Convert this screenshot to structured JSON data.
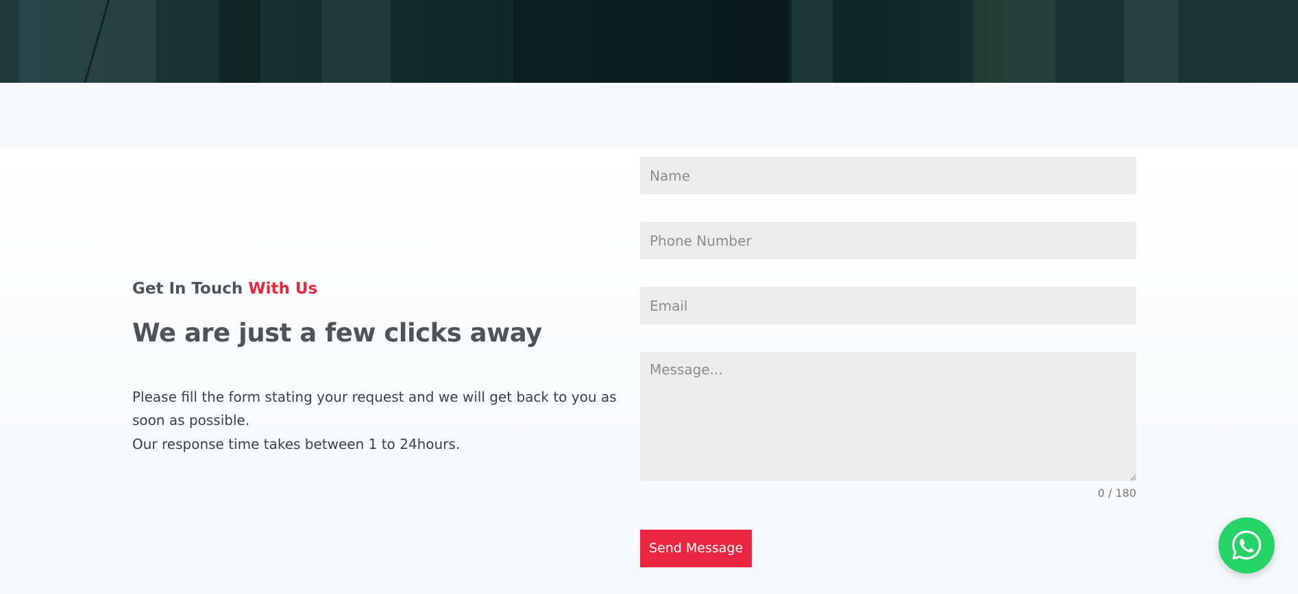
{
  "hero": {
    "image_description": "dark teal-tinted interior photo banner"
  },
  "contact": {
    "eyebrow_prefix": "Get In Touch",
    "eyebrow_accent": "With Us",
    "headline": "We are just a few clicks away",
    "description_line1": "Please fill the form stating your request and we will get back to you as soon as possible.",
    "description_line2": "Our response time takes between 1 to 24hours."
  },
  "form": {
    "name_placeholder": "Name",
    "name_value": "",
    "phone_placeholder": "Phone Number",
    "phone_value": "",
    "email_placeholder": "Email",
    "email_value": "",
    "message_placeholder": "Message...",
    "message_value": "",
    "counter": "0 / 180",
    "submit_label": "Send Message"
  },
  "floating": {
    "whatsapp_icon": "whatsapp-icon"
  },
  "colors": {
    "accent": "#e8263e",
    "button": "#ea253f",
    "whatsapp": "#25d366",
    "text_dark": "#4e535b",
    "field_bg": "#ececec"
  }
}
